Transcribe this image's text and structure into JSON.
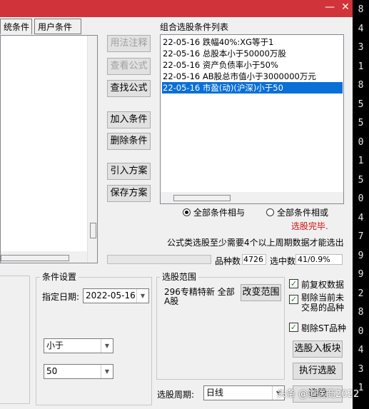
{
  "titlebar": {
    "minimize": "—",
    "close": "✕"
  },
  "tabs": {
    "system_partial": "统条件",
    "user": "用户条件"
  },
  "buttons": {
    "usage_notes": "用法注释",
    "view_formula": "查看公式",
    "find_formula": "查找公式",
    "add_condition": "加入条件",
    "delete_condition": "删除条件",
    "import_plan": "引入方案",
    "save_plan": "保存方案",
    "change_range": "改变范围",
    "add_to_board": "选股入板块",
    "run_selection": "执行选股",
    "partial_bottom": "选股"
  },
  "condition_list": {
    "title": "组合选股条件列表",
    "items": [
      "22-05-16 跌幅40%:XG等于1",
      "22-05-16 总股本小于50000万股",
      "22-05-16 资产负债率小于50%",
      "22-05-16 AB股总市值小于3000000万元",
      "22-05-16 市盈(动)(沪深)小于50"
    ],
    "selected_index": 4
  },
  "logic": {
    "all_and": "全部条件相与",
    "all_or": "全部条件相或",
    "selected": "all_and"
  },
  "status": {
    "done": "选股完毕.",
    "notice": "公式类选股至少需要4个以上周期数据才能选出",
    "total_label": "品种数",
    "total_value": "4726",
    "selected_label": "选中数",
    "selected_value": "41/0.9%"
  },
  "condition_settings": {
    "legend": "条件设置",
    "date_label": "指定日期:",
    "date_value": "2022-05-16",
    "operator": "小于",
    "value": "50"
  },
  "range": {
    "legend": "选股范围",
    "text": "296专精特新 全部A股"
  },
  "options": {
    "pre_adjust": {
      "label": "前复权数据",
      "checked": true
    },
    "exclude_suspended": {
      "label": "剔除当前未交易的品种",
      "checked": true
    },
    "exclude_st": {
      "label": "剔除ST品种",
      "checked": true
    }
  },
  "period": {
    "label": "选股周期:",
    "value": "日线"
  },
  "right_digits": [
    "8",
    "4",
    "3",
    "1",
    "8",
    "5",
    "5",
    "0",
    "1",
    "5",
    "0",
    "4",
    "7",
    "9",
    "9",
    "2",
    "8",
    "0",
    "4",
    "3",
    "1"
  ],
  "watermark": "头条 @道医商2022",
  "colors": {
    "titlebar": "#d0343a",
    "selection": "#0a6fd6",
    "done_text": "#d01010",
    "check": "#1a8a1a"
  }
}
